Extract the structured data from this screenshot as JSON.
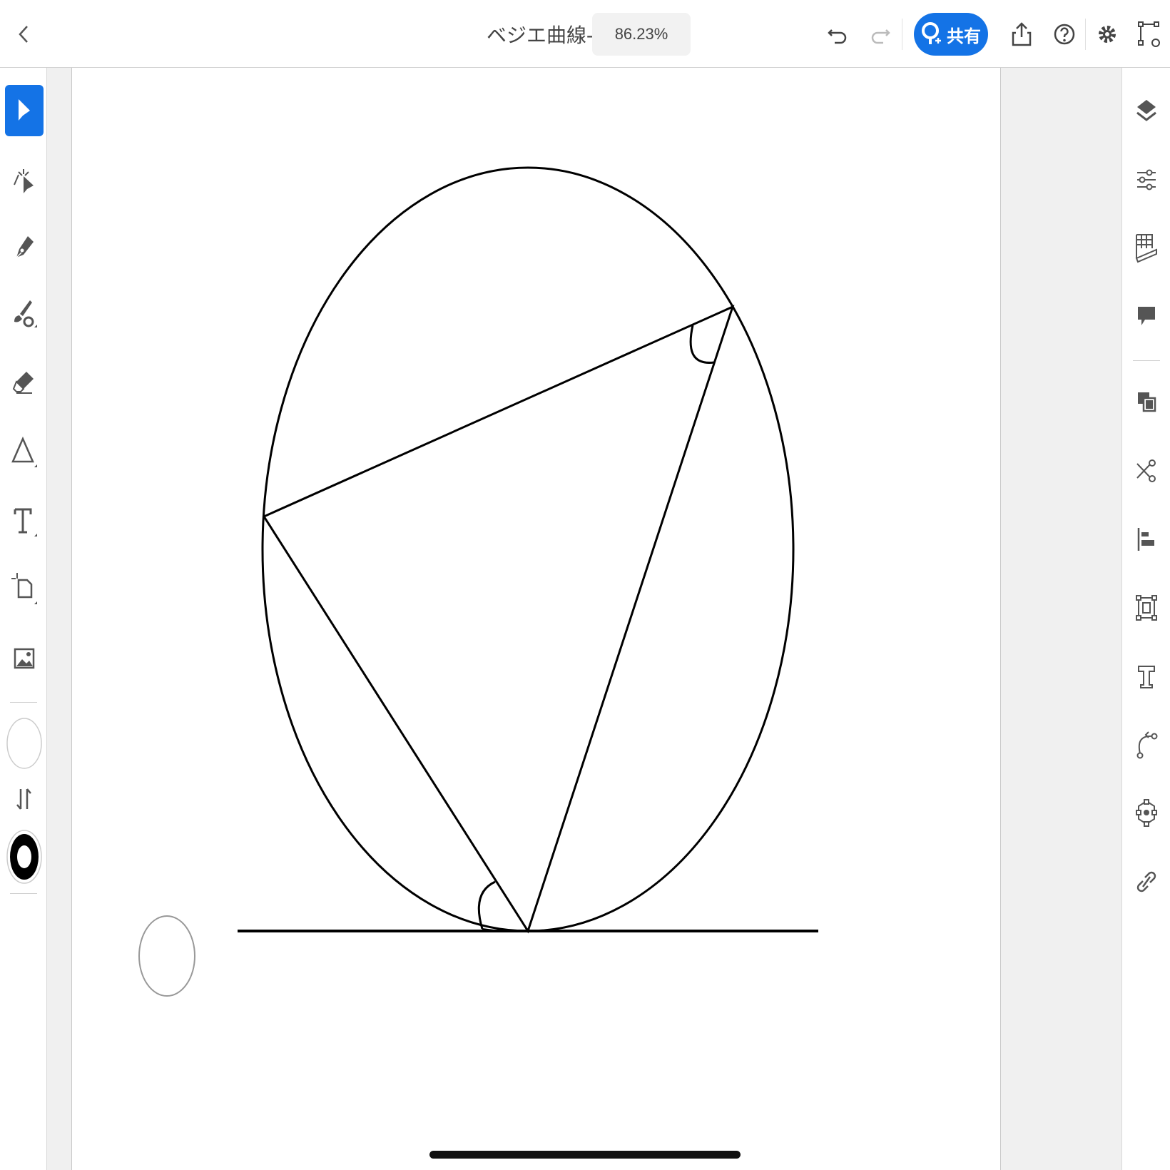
{
  "header": {
    "back_icon": "chevron-left-icon",
    "doc_title": "ベジエ曲線-*",
    "zoom": "86.23%",
    "share_label": "共有",
    "undo_icon": "undo-icon",
    "redo_icon": "redo-icon",
    "export_icon": "share-upload-icon",
    "help_icon": "help-icon",
    "settings_icon": "gear-icon",
    "path_icon": "path-edit-icon"
  },
  "left_tools": [
    {
      "name": "selection-tool",
      "icon": "arrow-pointer-icon",
      "active": true
    },
    {
      "name": "direct-selection-tool",
      "icon": "direct-select-icon"
    },
    {
      "name": "pen-tool",
      "icon": "pen-icon"
    },
    {
      "name": "brush-tool",
      "icon": "brush-icon"
    },
    {
      "name": "eraser-tool",
      "icon": "eraser-icon"
    },
    {
      "name": "shape-tool",
      "icon": "triangle-icon"
    },
    {
      "name": "text-tool",
      "icon": "text-t-icon"
    },
    {
      "name": "artboard-tool",
      "icon": "artboard-icon"
    },
    {
      "name": "image-tool",
      "icon": "image-icon"
    }
  ],
  "right_tools": [
    {
      "name": "layers-panel",
      "icon": "layers-icon"
    },
    {
      "name": "properties-panel",
      "icon": "sliders-icon"
    },
    {
      "name": "grid-ruler-panel",
      "icon": "grid-ruler-icon"
    },
    {
      "name": "comments-panel",
      "icon": "comment-icon"
    },
    {
      "name": "arrange-panel",
      "icon": "arrange-icon"
    },
    {
      "name": "cut-panel",
      "icon": "scissors-icon"
    },
    {
      "name": "align-panel",
      "icon": "align-left-icon"
    },
    {
      "name": "transform-panel",
      "icon": "transform-icon"
    },
    {
      "name": "type-panel",
      "icon": "type-icon"
    },
    {
      "name": "curve-panel",
      "icon": "curve-icon"
    },
    {
      "name": "repeat-panel",
      "icon": "repeat-grid-icon"
    },
    {
      "name": "link-panel",
      "icon": "link-icon"
    }
  ],
  "colors": {
    "accent": "#1473e6",
    "stroke": "#000000",
    "fill": "#ffffff"
  }
}
